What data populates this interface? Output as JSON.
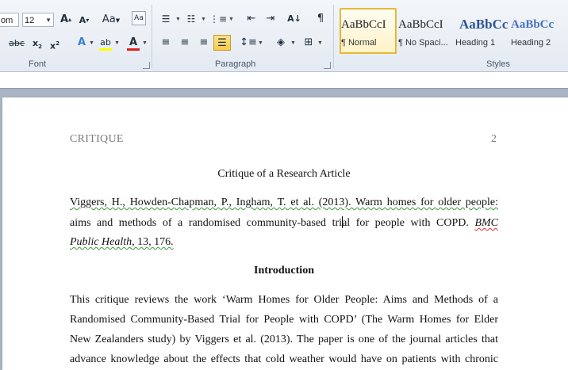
{
  "ribbon": {
    "font": {
      "label": "Font",
      "font_name_value": "om",
      "font_size_value": "12",
      "grow_icon": "A",
      "shrink_icon": "A",
      "change_case_label": "Aa",
      "strike_label": "abc",
      "subscript_label": "x",
      "superscript_label": "x",
      "text_effects_label": "A",
      "highlight_label": "ab",
      "font_color_label": "A",
      "highlight_color": "#ffff00",
      "font_color": "#e02020"
    },
    "paragraph": {
      "label": "Paragraph",
      "show_marks_label": "¶"
    },
    "styles": {
      "label": "Styles",
      "items": [
        {
          "sample": "AaBbCcI",
          "name": "¶ Normal",
          "selected": true
        },
        {
          "sample": "AaBbCcI",
          "name": "¶ No Spaci...",
          "selected": false
        },
        {
          "sample": "AaBbCc",
          "name": "Heading 1",
          "selected": false
        },
        {
          "sample": "AaBbCc",
          "name": "Heading 2",
          "selected": false
        }
      ]
    }
  },
  "document": {
    "header_left": "CRITIQUE",
    "header_right": "2",
    "title": "Critique of a Research Article",
    "reference": {
      "line1": "Viggers, H., Howden-Chapman, P., Ingham, T. et al. (2013). Warm homes for older people:",
      "line2_a": "aims and methods of a randomised community-based tri",
      "line2_b": "al for people with COPD. ",
      "line2_journal": "BMC",
      "line3_journal": "Public Health",
      "line3_rest": ", 13, 176."
    },
    "intro_heading": "Introduction",
    "body_lines": [
      "This critique reviews the work ‘Warm Homes for Older People: Aims and Methods of a",
      "Randomised Community-Based Trial for People with COPD’ (The Warm Homes for Elder",
      "New Zealanders study) by Viggers et al. (2013). The paper is one of the journal articles that",
      "advance knowledge about the effects that cold weather would have on patients with chronic"
    ]
  }
}
